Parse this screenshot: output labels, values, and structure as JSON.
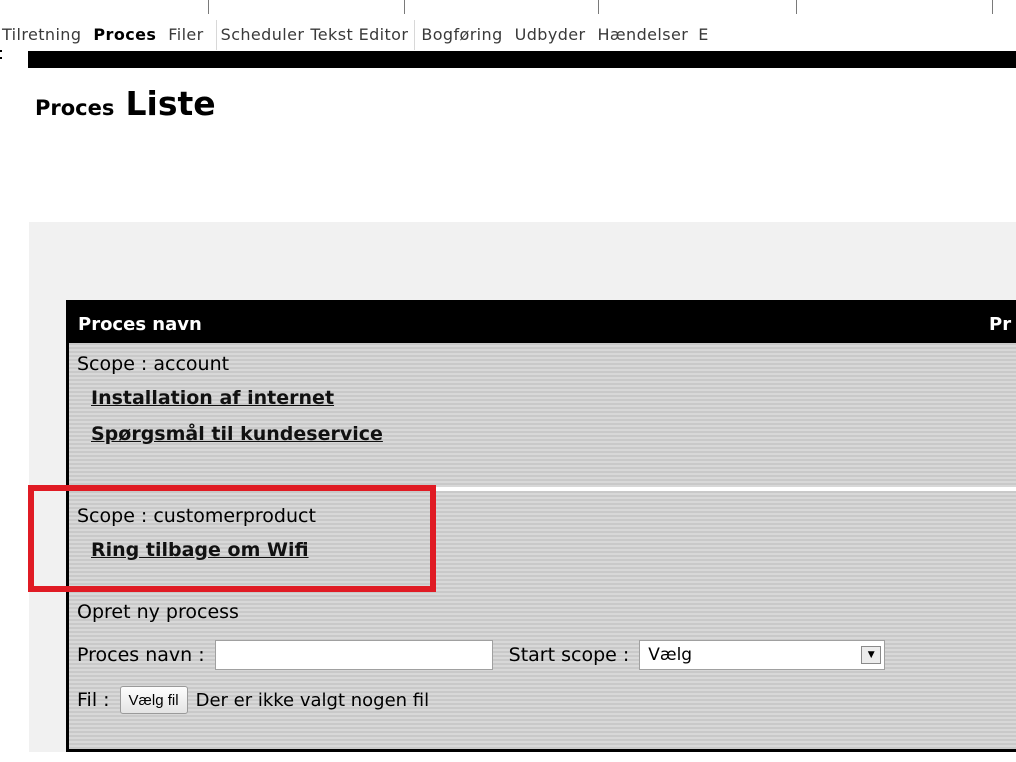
{
  "tabs": [
    {
      "label": "Tilretning",
      "active": false
    },
    {
      "label": "Proces",
      "active": true
    },
    {
      "label": "Filer",
      "active": false
    },
    {
      "label": "Scheduler",
      "active": false
    },
    {
      "label": "Tekst Editor",
      "active": false
    },
    {
      "label": "Bogføring",
      "active": false
    },
    {
      "label": "Udbyder",
      "active": false
    },
    {
      "label": "Hændelser",
      "active": false
    },
    {
      "label": "E",
      "active": false
    }
  ],
  "title": {
    "small": "Proces",
    "big": "Liste"
  },
  "table": {
    "header_col1": "Proces navn",
    "header_col2": "Pr",
    "sections": [
      {
        "scope": "Scope : account",
        "links": [
          "Installation af internet",
          "Spørgsmål til kundeservice"
        ]
      },
      {
        "scope": "Scope : customerproduct",
        "links": [
          "Ring tilbage om Wifi"
        ]
      }
    ]
  },
  "create": {
    "title": "Opret ny process",
    "name_label": "Proces navn :",
    "name_value": "",
    "scope_label": "Start scope :",
    "scope_selected": "Vælg",
    "file_label": "Fil :",
    "file_button": "Vælg fil",
    "file_status": "Der er ikke valgt nogen fil"
  },
  "colors": {
    "highlight": "#e01b24",
    "header_bg": "#000000",
    "panel_bg": "#f1f1f1"
  }
}
